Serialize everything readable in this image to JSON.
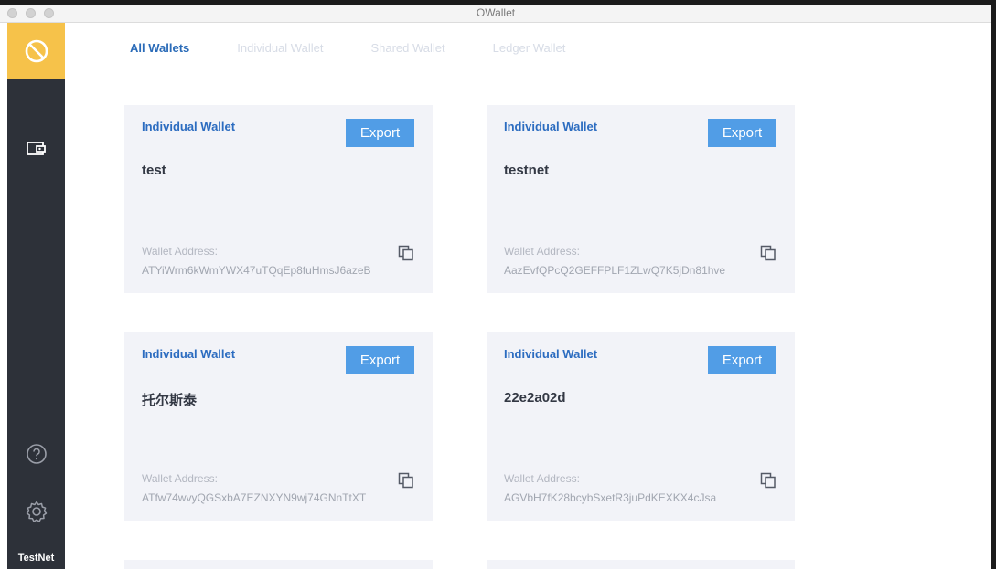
{
  "window": {
    "title": "OWallet"
  },
  "sidebar": {
    "network": "TestNet",
    "items": [
      {
        "name": "logo-icon"
      },
      {
        "name": "wallet-icon"
      },
      {
        "name": "help-icon"
      },
      {
        "name": "settings-icon"
      }
    ]
  },
  "tabs": [
    {
      "label": "All Wallets",
      "active": true
    },
    {
      "label": "Individual Wallet",
      "active": false
    },
    {
      "label": "Shared Wallet",
      "active": false
    },
    {
      "label": "Ledger Wallet",
      "active": false
    }
  ],
  "wallets": [
    {
      "type": "Individual Wallet",
      "export_label": "Export",
      "name": "test",
      "address_label": "Wallet Address:",
      "address": "ATYiWrm6kWmYWX47uTQqEp8fuHmsJ6azeB"
    },
    {
      "type": "Individual Wallet",
      "export_label": "Export",
      "name": "testnet",
      "address_label": "Wallet Address:",
      "address": "AazEvfQPcQ2GEFFPLF1ZLwQ7K5jDn81hve"
    },
    {
      "type": "Individual Wallet",
      "export_label": "Export",
      "name": "托尔斯泰",
      "address_label": "Wallet Address:",
      "address": "ATfw74wvyQGSxbA7EZNXYN9wj74GNnTtXT"
    },
    {
      "type": "Individual Wallet",
      "export_label": "Export",
      "name": "22e2a02d",
      "address_label": "Wallet Address:",
      "address": "AGVbH7fK28bcybSxetR3juPdKEXKX4cJsa"
    }
  ],
  "colors": {
    "accent": "#519de6",
    "logo_bg": "#f6c24a",
    "sidebar_bg": "#2d3139",
    "active_tab": "#2a6bb8"
  }
}
